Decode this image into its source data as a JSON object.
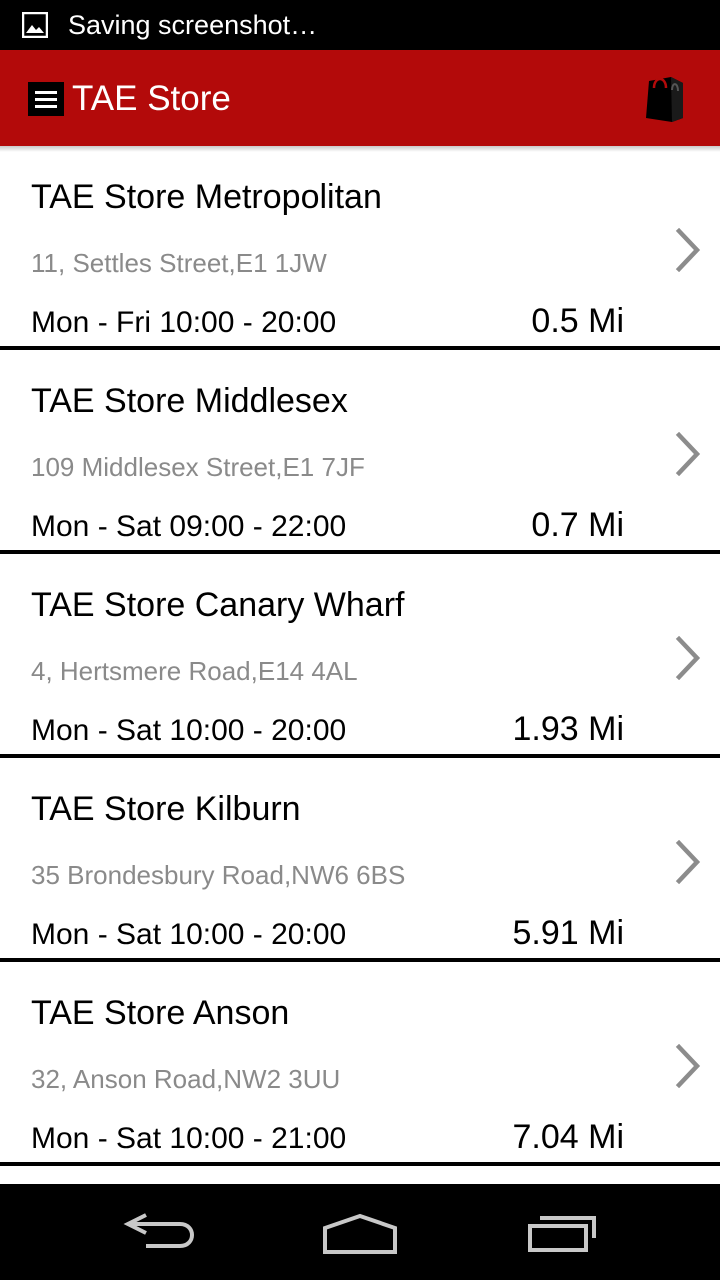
{
  "status_bar": {
    "text": "Saving screenshot…",
    "icon": "image-icon"
  },
  "app_bar": {
    "title": "TAE Store",
    "menu_icon": "hamburger-menu-icon",
    "action_icon": "shopping-bag-icon"
  },
  "stores": [
    {
      "name": "TAE Store Metropolitan",
      "address": "11, Settles Street,E1 1JW",
      "hours": "Mon - Fri 10:00 - 20:00",
      "distance": "0.5 Mi"
    },
    {
      "name": "TAE Store Middlesex",
      "address": "109 Middlesex Street,E1 7JF",
      "hours": "Mon - Sat 09:00 - 22:00",
      "distance": "0.7 Mi"
    },
    {
      "name": "TAE Store Canary Wharf",
      "address": "4, Hertsmere Road,E14 4AL",
      "hours": "Mon - Sat 10:00 - 20:00",
      "distance": "1.93 Mi"
    },
    {
      "name": "TAE Store Kilburn",
      "address": "35 Brondesbury Road,NW6 6BS",
      "hours": "Mon - Sat 10:00 - 20:00",
      "distance": "5.91 Mi"
    },
    {
      "name": "TAE Store Anson",
      "address": "32, Anson Road,NW2 3UU",
      "hours": "Mon - Sat 10:00 - 21:00",
      "distance": "7.04 Mi"
    }
  ],
  "nav_bar": {
    "back_icon": "back-icon",
    "home_icon": "home-icon",
    "recents_icon": "recent-apps-icon"
  },
  "colors": {
    "app_bar": "#b30a0a",
    "secondary_text": "#8a8a8a",
    "chevron": "#8c8c8c"
  }
}
